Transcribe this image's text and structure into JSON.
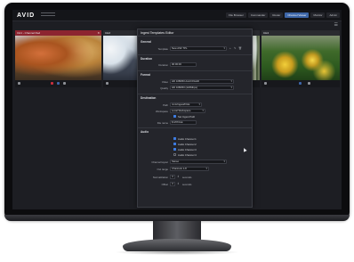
{
  "app": {
    "logo": "AVID"
  },
  "nav": {
    "tabs": [
      {
        "label": "File Browser"
      },
      {
        "label": "Commander"
      },
      {
        "label": "Router"
      },
      {
        "label": "Channel Viewer",
        "active": true
      },
      {
        "label": "Monitor"
      },
      {
        "label": "Admin"
      }
    ]
  },
  "tiles": [
    {
      "label": "CH1 - Channel Red",
      "closable": true
    },
    {
      "label": "CH2"
    },
    {
      "label": "CH3"
    },
    {
      "label": "CH4"
    }
  ],
  "dialog": {
    "title": "Ingest Templates Editor",
    "sections": {
      "general": "General",
      "duration": "Duration",
      "format": "Format",
      "destination": "Destination",
      "audio": "Audio"
    },
    "template": {
      "label": "Template",
      "value": "New ASF TPL"
    },
    "duration": {
      "label": "Duration",
      "value": "00:00:00"
    },
    "format": {
      "video": {
        "label": "Video",
        "value": "HD 1080i50 Avid DNxHD"
      },
      "quality": {
        "label": "Quality",
        "value": "HD 1080i50 (220Mbps)"
      }
    },
    "destination": {
      "path": {
        "label": "Path",
        "value": "/mnt/ingest/FILE"
      },
      "workspace": {
        "label": "Workspace",
        "value": "Local Workspace"
      },
      "option": {
        "label": "Set Ingest Path"
      },
      "filename": {
        "label": "File name",
        "value": "$ MYFILE"
      }
    },
    "audio": {
      "checks": [
        {
          "label": "Audio Channel 1",
          "checked": true
        },
        {
          "label": "Audio Channel 2",
          "checked": true
        },
        {
          "label": "Audio Channel 3",
          "checked": true
        },
        {
          "label": "Audio Channel 4",
          "checked": false
        }
      ],
      "channel_layout": {
        "label": "Channel layout",
        "value": "Stereo"
      },
      "out_range": {
        "label": "Out range",
        "value": "Channels 1-8"
      },
      "normalization": {
        "label": "Normalization",
        "value": "0",
        "unit": "seconds"
      },
      "offset": {
        "label": "Offset",
        "value": "0",
        "unit": "seconds"
      }
    }
  },
  "colors": {
    "accent": "#3d66a8",
    "screen_bg": "#1d1e23",
    "dialog_bg": "#24252b"
  }
}
